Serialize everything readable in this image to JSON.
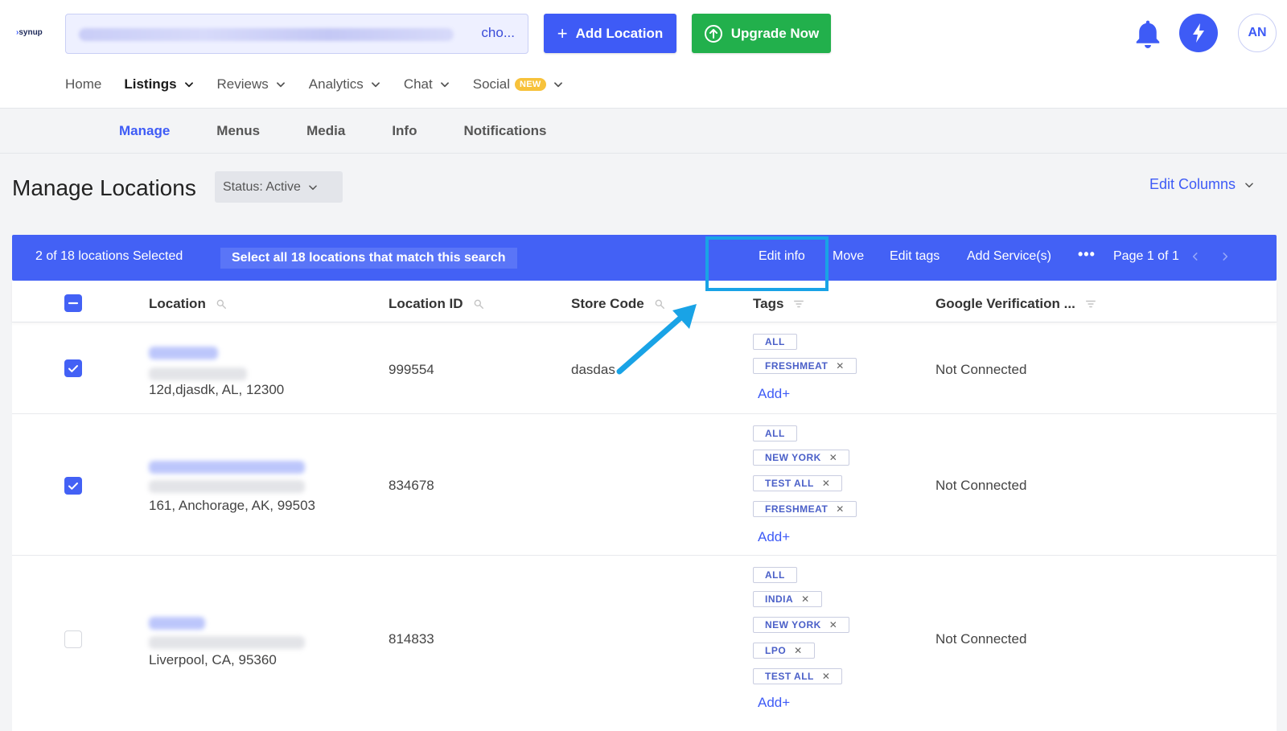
{
  "header": {
    "logo_text": "synup",
    "account_selector_tail": "cho...",
    "add_location_label": "Add Location",
    "upgrade_label": "Upgrade Now",
    "avatar_initials": "AN"
  },
  "main_nav": {
    "items": [
      {
        "label": "Home"
      },
      {
        "label": "Listings"
      },
      {
        "label": "Reviews"
      },
      {
        "label": "Analytics"
      },
      {
        "label": "Chat"
      },
      {
        "label": "Social",
        "badge": "NEW"
      }
    ]
  },
  "sub_nav": {
    "tabs": [
      "Manage",
      "Menus",
      "Media",
      "Info",
      "Notifications"
    ]
  },
  "page": {
    "title": "Manage Locations",
    "status_filter": "Status: Active",
    "edit_columns": "Edit Columns"
  },
  "selection_bar": {
    "count_text": "2 of 18 locations Selected",
    "select_all_text": "Select all 18 locations that match this search",
    "actions": [
      "Edit info",
      "Move",
      "Edit tags",
      "Add Service(s)"
    ],
    "more": "•••",
    "pager": "Page 1 of 1"
  },
  "table": {
    "columns": [
      "Location",
      "Location ID",
      "Store Code",
      "Tags",
      "Google Verification ..."
    ],
    "add_tag_label": "Add+",
    "rows": [
      {
        "address": "12d,djasdk, AL, 12300",
        "location_id": "999554",
        "store_code": "dasdas",
        "tags": [
          "ALL",
          "FRESHMEAT"
        ],
        "google_verification": "Not Connected",
        "checked": true
      },
      {
        "address": "161, Anchorage, AK, 99503",
        "location_id": "834678",
        "store_code": "",
        "tags": [
          "ALL",
          "NEW YORK",
          "TEST ALL",
          "FRESHMEAT"
        ],
        "google_verification": "Not Connected",
        "checked": true
      },
      {
        "address": "Liverpool, CA, 95360",
        "location_id": "814833",
        "store_code": "",
        "tags": [
          "ALL",
          "INDIA",
          "NEW YORK",
          "LPO",
          "TEST ALL"
        ],
        "google_verification": "Not Connected",
        "checked": false
      }
    ]
  },
  "colors": {
    "primary": "#3e5bf6",
    "selection_bar": "#4361f5",
    "upgrade_green": "#22b04c",
    "highlight_blue": "#19a3e6",
    "badge_yellow": "#f7c23b"
  }
}
